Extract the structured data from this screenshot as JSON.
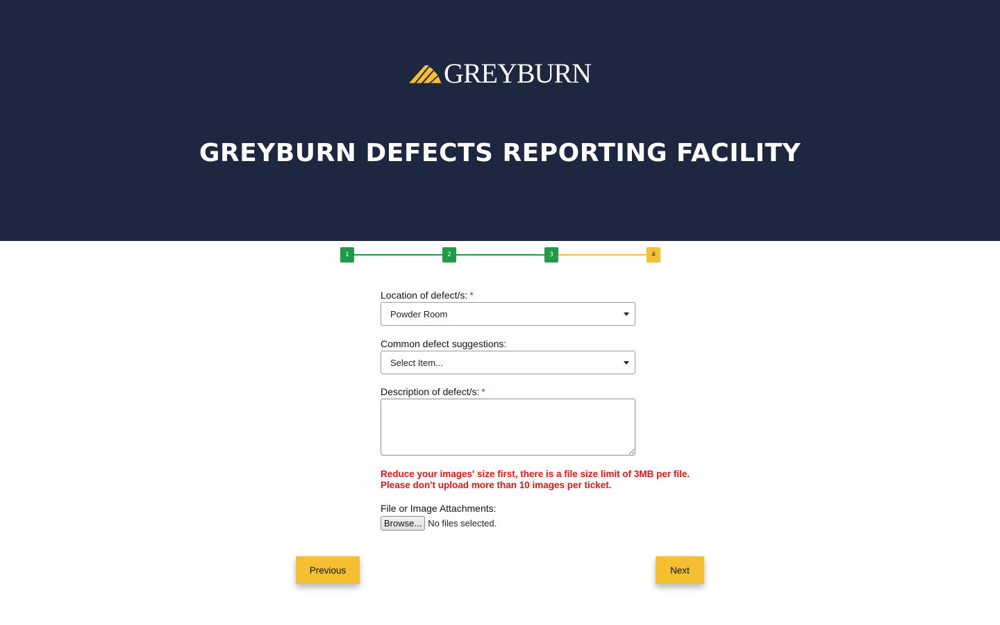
{
  "header": {
    "brand": "GREYBURN",
    "title": "GREYBURN DEFECTS REPORTING FACILITY",
    "brand_color": "#1d2740",
    "accent_color": "#f4bf30"
  },
  "stepper": {
    "steps": [
      "1",
      "2",
      "3",
      "4"
    ],
    "current_step": 4,
    "done_color": "#1f9a47"
  },
  "form": {
    "location": {
      "label": "Location of defect/s:",
      "required_mark": "*",
      "value": "Powder Room"
    },
    "suggestions": {
      "label": "Common defect suggestions:",
      "value": "Select Item..."
    },
    "description": {
      "label": "Description of defect/s:",
      "required_mark": "*",
      "value": ""
    },
    "warning_line1": "Reduce your images' size first, there is a file size limit of 3MB per file.",
    "warning_line2": "Please don't upload more than 10 images per ticket.",
    "attachments": {
      "label": "File or Image Attachments:",
      "browse_label": "Browse...",
      "status": "No files selected."
    }
  },
  "nav": {
    "previous_label": "Previous",
    "next_label": "Next"
  }
}
